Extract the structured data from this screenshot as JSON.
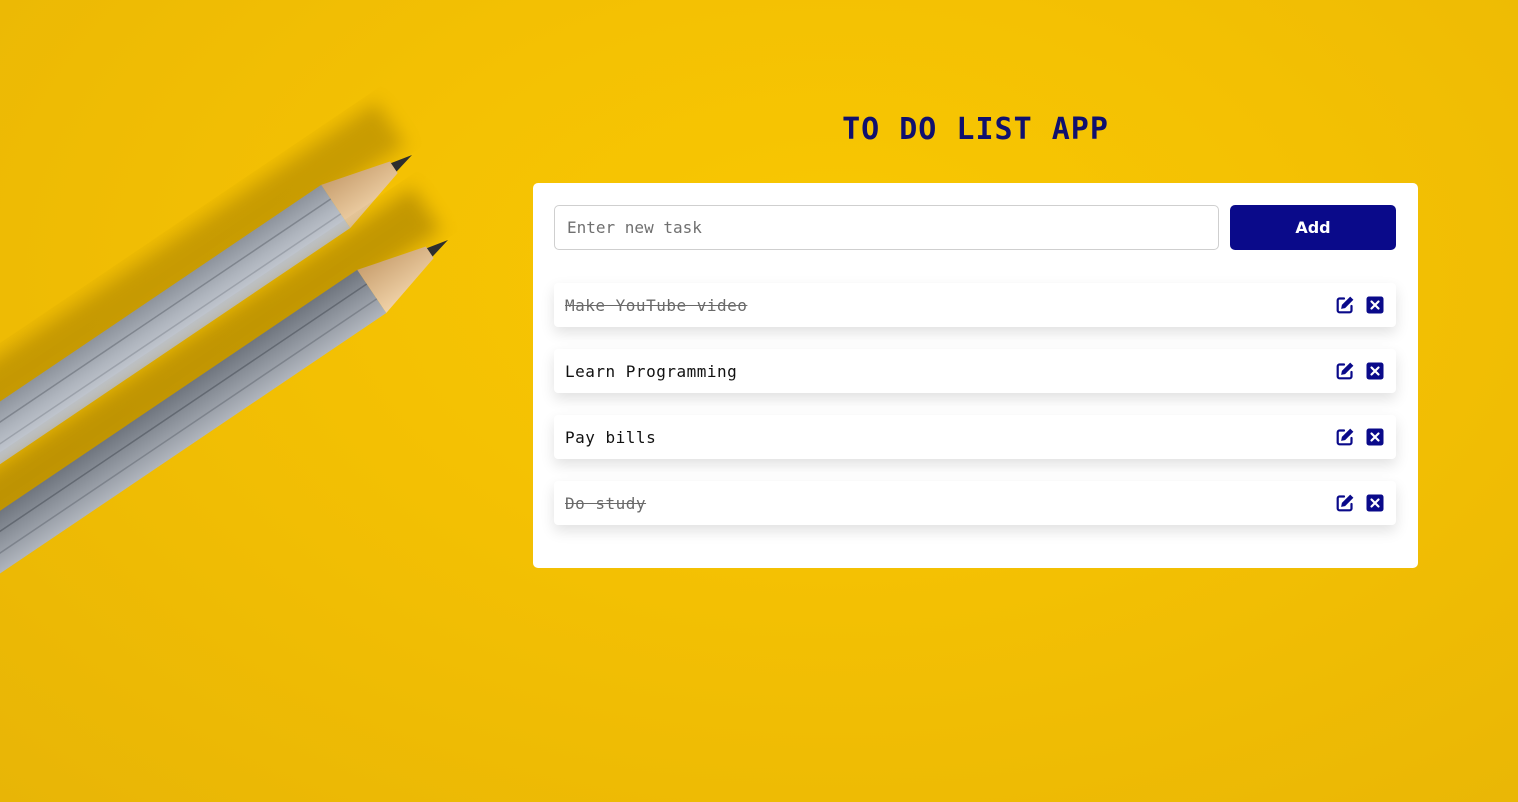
{
  "app": {
    "title": "TO DO LIST APP"
  },
  "form": {
    "input_value": "",
    "input_placeholder": "Enter new task",
    "add_label": "Add"
  },
  "tasks": [
    {
      "text": "Make YouTube video",
      "completed": true
    },
    {
      "text": "Learn Programming",
      "completed": false
    },
    {
      "text": "Pay bills",
      "completed": false
    },
    {
      "text": "Do study",
      "completed": true
    }
  ],
  "icons": {
    "edit": "edit-icon",
    "delete": "delete-icon",
    "background": "pencils-illustration"
  },
  "colors": {
    "accent": "#0a0a8a",
    "title": "#10106e",
    "background": "#f5c203",
    "card": "#ffffff",
    "completed_text": "#6a6a6a"
  }
}
